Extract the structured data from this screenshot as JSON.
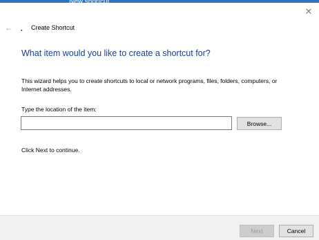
{
  "desktop": {
    "label": "New shortcut"
  },
  "window": {
    "title": "Create Shortcut",
    "close_glyph": "✕",
    "back_glyph": "←",
    "icon": "shortcut-icon",
    "icon_glyph": "▪"
  },
  "main": {
    "heading": "What item would you like to create a shortcut for?",
    "description": "This wizard helps you to create shortcuts to local or network programs, files, folders, computers, or Internet addresses.",
    "location_label": "Type the location of the item:",
    "location_value": "",
    "location_placeholder": "",
    "browse_label": "Browse...",
    "continue_text": "Click Next to continue."
  },
  "footer": {
    "next_label": "Next",
    "cancel_label": "Cancel"
  },
  "colors": {
    "heading": "#1a3c8f",
    "desktop": "#1b5fa6"
  }
}
